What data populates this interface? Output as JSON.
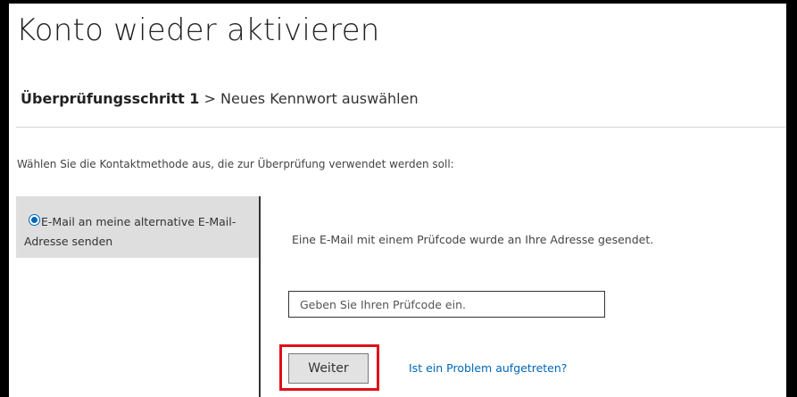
{
  "page": {
    "title": "Konto wieder aktivieren"
  },
  "breadcrumb": {
    "current": "Überprüfungsschritt 1",
    "separator": " > ",
    "next": "Neues Kennwort auswählen"
  },
  "instruction": "Wählen Sie die Kontaktmethode aus, die zur Überprüfung verwendet werden soll:",
  "contact_methods": [
    {
      "label": "E-Mail an meine alternative E-Mail-Adresse senden",
      "selected": true
    }
  ],
  "verification": {
    "message": "Eine E-Mail mit einem Prüfcode wurde an Ihre Adresse gesendet.",
    "code_placeholder": "Geben Sie Ihren Prüfcode ein.",
    "code_value": ""
  },
  "actions": {
    "next_label": "Weiter",
    "problem_link": "Ist ein Problem aufgetreten?"
  },
  "colors": {
    "accent": "#0067b8",
    "highlight": "#e0101a",
    "option_bg": "#dedede"
  }
}
